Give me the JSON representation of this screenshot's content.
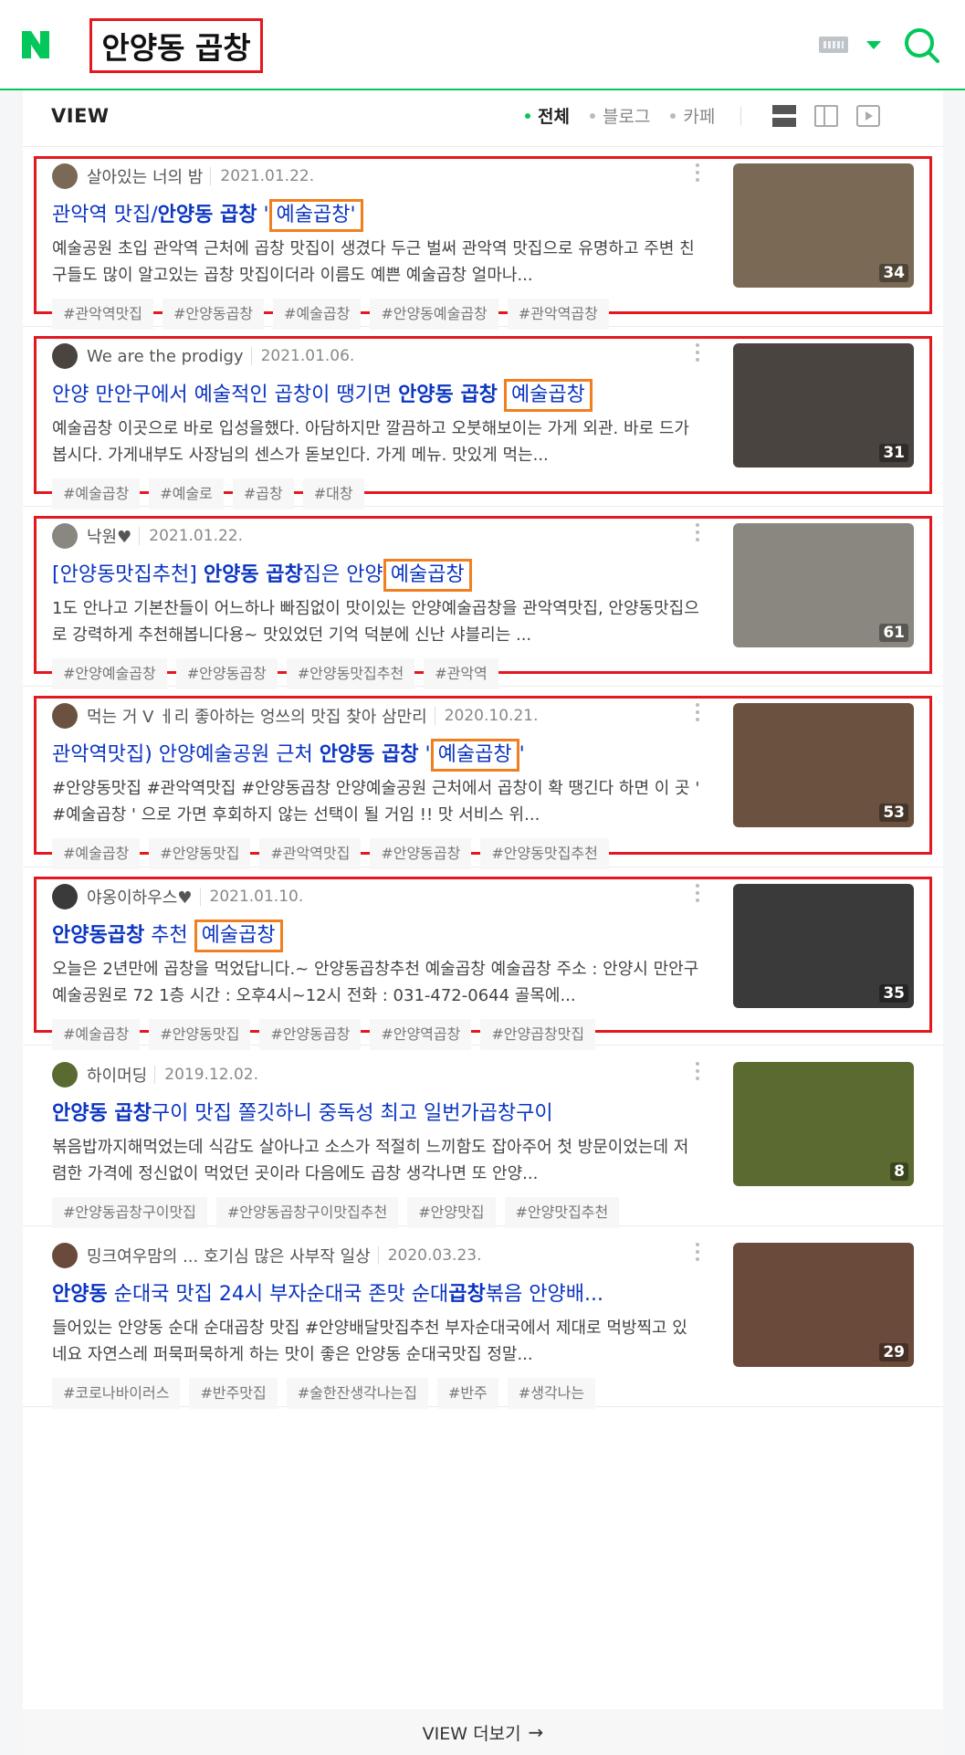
{
  "header": {
    "query": "안양동 곱창"
  },
  "view": {
    "title": "VIEW",
    "filters": [
      "전체",
      "블로그",
      "카페"
    ],
    "more_label": "VIEW 더보기"
  },
  "items": [
    {
      "author": "살아있는 너의 밤",
      "date": "2021.01.22.",
      "title_parts": [
        [
          "관악역 맛집/",
          ""
        ],
        [
          "안양동 곱창",
          "b"
        ],
        [
          " '",
          ""
        ],
        [
          "예술곱창'",
          "o"
        ]
      ],
      "desc": "예술공원 초입 관악역 근처에 곱창 맛집이 생겼다 두근 벌써 관악역 맛집으로 유명하고 주변 친구들도 많이 알고있는 곱창 맛집이더라 이름도 예쁜 예술곱창 얼마나...",
      "tags": [
        "#관악역맛집",
        "#안양동곱창",
        "#예술곱창",
        "#안양동예술곱창",
        "#관악역곱창"
      ],
      "count": "34",
      "thumb_color": "#7a6a55"
    },
    {
      "author": "We are the prodigy",
      "date": "2021.01.06.",
      "title_parts": [
        [
          "안양 만안구에서 예술적인 곱창이 땡기면 ",
          ""
        ],
        [
          "안양동 곱창",
          "b"
        ],
        [
          " ",
          ""
        ],
        [
          "예술곱창",
          "o"
        ]
      ],
      "desc": "예술곱창 이곳으로 바로 입성을했다. 아담하지만 깔끔하고 오붓해보이는 가게 외관. 바로 드가 봅시다. 가게내부도 사장님의 센스가 돋보인다. 가게 메뉴. 맛있게 먹는...",
      "tags": [
        "#예술곱창",
        "#예술로",
        "#곱창",
        "#대창"
      ],
      "count": "31",
      "thumb_color": "#4a4440"
    },
    {
      "author": "낙원♥",
      "date": "2021.01.22.",
      "title_parts": [
        [
          "[안양동맛집추천] ",
          ""
        ],
        [
          "안양동 곱창",
          "b"
        ],
        [
          "집은 안양",
          ""
        ],
        [
          "예술곱창",
          "o"
        ]
      ],
      "desc": "1도 안나고 기본찬들이 어느하나 빠짐없이 맛이있는 안양예술곱창을 관악역맛집, 안양동맛집으로 강력하게 추천해봅니다용~ 맛있었던 기억 덕분에 신난 샤블리는 ...",
      "tags": [
        "#안양예술곱창",
        "#안양동곱창",
        "#안양동맛집추천",
        "#관악역"
      ],
      "count": "61",
      "thumb_color": "#8a8680"
    },
    {
      "author": "먹는 거 V ㅔ리 좋아하는 엉쓰의 맛집 찾아 삼만리",
      "date": "2020.10.21.",
      "title_parts": [
        [
          "관악역맛집) 안양예술공원 근처 ",
          ""
        ],
        [
          "안양동 곱창",
          "b"
        ],
        [
          " '",
          ""
        ],
        [
          "예술곱창",
          "o"
        ],
        [
          "'",
          ""
        ]
      ],
      "desc": "#안양동맛집 #관악역맛집 #안양동곱창 안양예술공원 근처에서 곱창이 확 땡긴다 하면 이 곳 ' #예술곱창 ' 으로 가면 후회하지 않는 선택이 될 거임 !! 맛 서비스 위...",
      "tags": [
        "#예술곱창",
        "#안양동맛집",
        "#관악역맛집",
        "#안양동곱창",
        "#안양동맛집추천"
      ],
      "count": "53",
      "thumb_color": "#6b5240"
    },
    {
      "author": "야옹이하우스♥",
      "date": "2021.01.10.",
      "title_parts": [
        [
          "안양동곱창",
          "b"
        ],
        [
          " 추천 ",
          ""
        ],
        [
          "예술곱창",
          "o"
        ]
      ],
      "desc": "오늘은 2년만에 곱창을 먹었답니다.~ 안양동곱창추천 예술곱창 예술곱창 주소 : 안양시 만안구 예술공원로 72 1층 시간 : 오후4시~12시 전화 : 031-472-0644 골목에...",
      "tags": [
        "#예술곱창",
        "#안양동맛집",
        "#안양동곱창",
        "#안양역곱창",
        "#안양곱창맛집"
      ],
      "count": "35",
      "thumb_color": "#3a3a3a"
    },
    {
      "author": "하이머딩",
      "date": "2019.12.02.",
      "title_parts": [
        [
          "안양동 곱창",
          "b"
        ],
        [
          "구이 맛집 쫄깃하니 중독성 최고 일번가곱창구이",
          ""
        ]
      ],
      "desc": "볶음밥까지해먹었는데 식감도 살아나고 소스가 적절히 느끼함도 잡아주어 첫 방문이었는데 저렴한 가격에 정신없이 먹었던 곳이라 다음에도 곱창 생각나면 또 안양...",
      "tags": [
        "#안양동곱창구이맛집",
        "#안양동곱창구이맛집추천",
        "#안양맛집",
        "#안양맛집추천"
      ],
      "count": "8",
      "thumb_color": "#5a6a30"
    },
    {
      "author": "밍크여우맘의 ... 호기심 많은 사부작 일상",
      "date": "2020.03.23.",
      "title_parts": [
        [
          "안양동",
          "b"
        ],
        [
          " 순대국 맛집 24시 부자순대국 존맛 순대",
          ""
        ],
        [
          "곱창",
          "b"
        ],
        [
          "볶음 안양배...",
          ""
        ]
      ],
      "desc": "들어있는 안양동 순대 순대곱창 맛집 #안양배달맛집추천 부자순대국에서 제대로 먹방찍고 있네요 자연스레 퍼묵퍼묵하게 하는 맛이 좋은 안양동 순대국맛집 정말...",
      "tags": [
        "#코로나바이러스",
        "#반주맛집",
        "#술한잔생각나는집",
        "#반주",
        "#생각나는"
      ],
      "count": "29",
      "thumb_color": "#6a4a3a"
    }
  ],
  "colors": {
    "brand_green": "#03c75a",
    "highlight_red": "#e4181f",
    "highlight_orange": "#f0801f",
    "link_blue": "#0b35c1"
  }
}
